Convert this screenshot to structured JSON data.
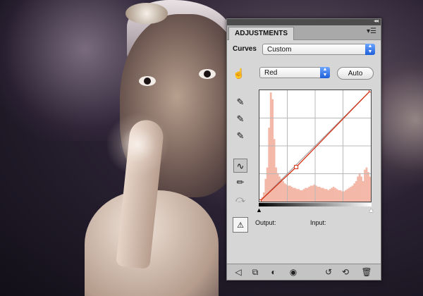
{
  "panel": {
    "tab_label": "ADJUSTMENTS",
    "preset_label": "Curves",
    "preset_value": "Custom",
    "channel_value": "Red",
    "auto_label": "Auto",
    "output_label": "Output:",
    "input_label": "Input:"
  },
  "icons": {
    "collapse": "double-chevron-right-icon",
    "panel_menu": "panel-menu-icon",
    "hand_tool": "on-image-adjust-hand-icon",
    "eyedropper_black": "eyedropper-black-icon",
    "eyedropper_gray": "eyedropper-gray-icon",
    "eyedropper_white": "eyedropper-white-icon",
    "curve_edit": "curve-edit-icon",
    "pencil": "pencil-draw-icon",
    "smooth": "smooth-curve-icon",
    "io_toggle": "clipping-display-icon",
    "bottom": [
      "back-arrow-icon",
      "expanded-view-icon",
      "clip-layer-icon",
      "visibility-eye-icon",
      "view-previous-icon",
      "reset-icon",
      "trash-icon"
    ]
  },
  "colors": {
    "panel_bg": "#d6d6d6",
    "histogram": "#f4b8a8",
    "curve": "#d82b10",
    "select_accent": "#1d5fd8"
  },
  "chart_data": {
    "type": "line",
    "histogram": [
      2,
      4,
      8,
      20,
      30,
      65,
      96,
      90,
      55,
      30,
      25,
      22,
      20,
      18,
      16,
      15,
      14,
      14,
      13,
      12,
      12,
      11,
      11,
      10,
      10,
      11,
      12,
      12,
      13,
      14,
      14,
      15,
      14,
      13,
      13,
      12,
      12,
      11,
      11,
      10,
      11,
      12,
      13,
      12,
      11,
      10,
      10,
      9,
      9,
      10,
      11,
      12,
      13,
      14,
      16,
      18,
      22,
      25,
      22,
      18,
      28,
      30,
      26,
      22
    ],
    "curve_points": [
      [
        0,
        0
      ],
      [
        0.33,
        0.31
      ],
      [
        1,
        1
      ]
    ],
    "xlim": [
      0,
      1
    ],
    "ylim": [
      0,
      1
    ]
  }
}
